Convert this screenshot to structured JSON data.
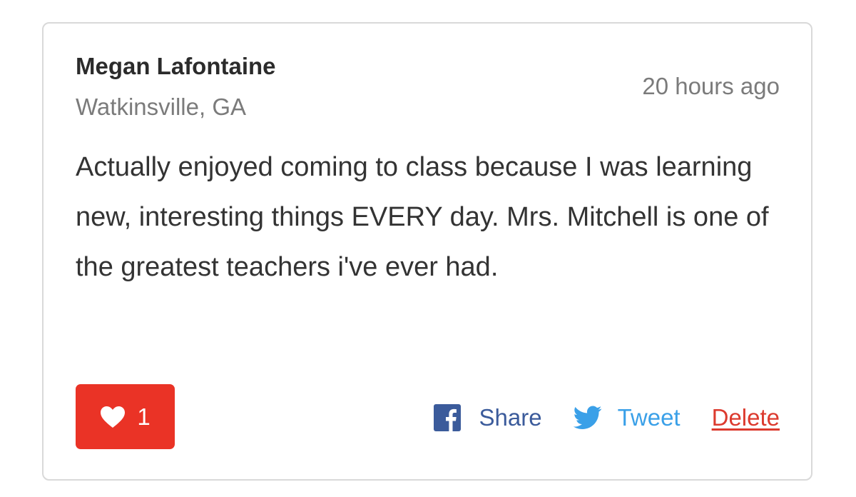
{
  "review": {
    "author_name": "Megan Lafontaine",
    "author_location": "Watkinsville, GA",
    "timestamp": "20 hours ago",
    "body": "Actually enjoyed coming to class because I was learning new, interesting things EVERY day. Mrs. Mitchell is one of the greatest teachers i've ever had."
  },
  "like": {
    "icon": "heart-icon",
    "count": "1",
    "color": "#ea3326"
  },
  "actions": {
    "share_label": "Share",
    "share_icon": "facebook-icon",
    "share_color": "#3b5b9b",
    "tweet_label": "Tweet",
    "tweet_icon": "twitter-bird-icon",
    "tweet_color": "#3aa0e8",
    "delete_label": "Delete",
    "delete_color": "#dc3a2e"
  }
}
